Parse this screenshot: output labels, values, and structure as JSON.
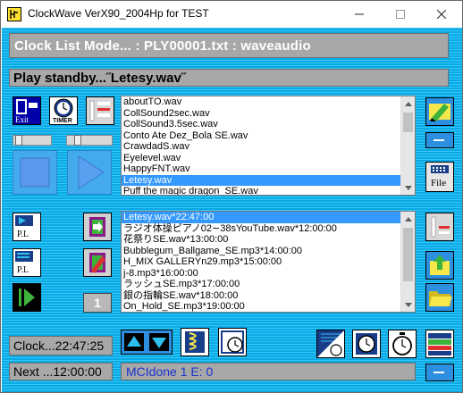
{
  "window": {
    "title": "ClockWave VerX90_2004Hp for TEST",
    "controls": {
      "minimize": "minimize",
      "maximize": "maximize",
      "close": "close"
    }
  },
  "mode_bar": {
    "text": "Clock List Mode...  : PLY00001.txt : waveaudio"
  },
  "status_bar": {
    "text": "Play standby...˝Letesy.wav˝"
  },
  "buttons": {
    "exit_label": "Exit",
    "timer_label": "TIMER",
    "file_label": "File",
    "pl_label": "P.L",
    "counter": "1"
  },
  "file_list": {
    "items": [
      "aboutTO.wav",
      "CollSound2sec.wav",
      "CollSound3.5sec.wav",
      "Conto Ate Dez_Bola SE.wav",
      "CrawdadS.wav",
      "Eyelevel.wav",
      "HappyFNT.wav",
      "Letesy.wav",
      "Puff the magic dragon_SE.wav"
    ],
    "selected": "Letesy.wav"
  },
  "schedule_list": {
    "items": [
      "Letesy.wav*22:47:00",
      "ラジオ体操ピアノ02∼38sYouTube.wav*12:00:00",
      "花祭りSE.wav*13:00:00",
      "Bubblegum_Ballgame_SE.mp3*14:00:00",
      "H_MIX GALLERYn29.mp3*15:00:00",
      "j-8.mp3*16:00:00",
      "ラッシュSE.mp3*17:00:00",
      "銀の指輪SE.wav*18:00:00",
      "On_Hold_SE.mp3*19:00:00"
    ],
    "selected": "Letesy.wav*22:47:00"
  },
  "clock": {
    "text": "Clock...22:47:25"
  },
  "next": {
    "text": "Next ...12:00:00"
  },
  "mci_status": {
    "text": "MCIdone  1 E: 0"
  },
  "colors": {
    "background": "#00b4f0",
    "panel_gray": "#a8a8a8",
    "selection": "#3399ff",
    "play_blue": "#5aa0f0",
    "status_text_blue": "#1a33cc"
  }
}
